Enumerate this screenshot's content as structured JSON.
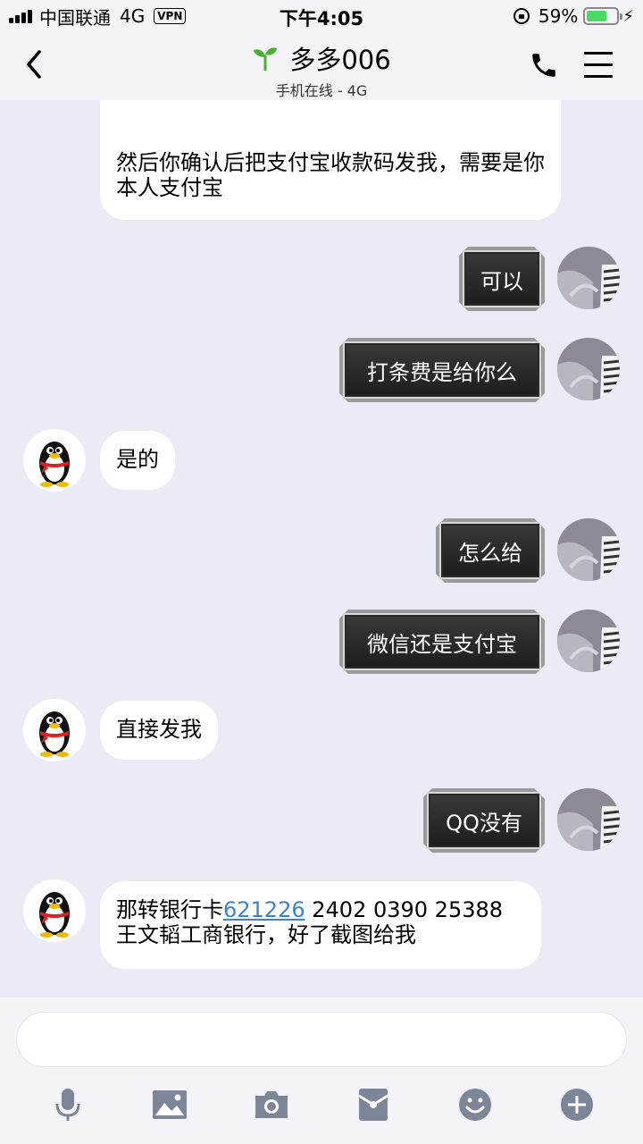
{
  "status_bar": {
    "carrier": "中国联通",
    "network": "4G",
    "vpn": "VPN",
    "time": "下午4:05",
    "battery_percent": "59%",
    "battery_level": 0.59
  },
  "header": {
    "title": "多多006",
    "subtitle": "手机在线 - 4G"
  },
  "messages": [
    {
      "from": "other",
      "text": "然后你确认后把支付宝收款码发我，需要是你本人支付宝"
    },
    {
      "from": "self",
      "text": "可以"
    },
    {
      "from": "self",
      "text": "打条费是给你么"
    },
    {
      "from": "other",
      "text": "是的"
    },
    {
      "from": "self",
      "text": "怎么给"
    },
    {
      "from": "self",
      "text": "微信还是支付宝"
    },
    {
      "from": "other",
      "text": "直接发我"
    },
    {
      "from": "self",
      "text": "QQ没有"
    },
    {
      "from": "other",
      "text_before": "那转银行卡",
      "link": "621226",
      "text_after": " 2402 0390 25388",
      "line2": "王文韬工商银行，好了截图给我"
    }
  ],
  "input": {
    "placeholder": ""
  },
  "toolbar": [
    "microphone-icon",
    "image-icon",
    "camera-icon",
    "red-packet-icon",
    "emoji-icon",
    "plus-icon"
  ],
  "colors": {
    "background": "#ebebf5",
    "link": "#3b82d6",
    "toolbar_icon": "#7d8599",
    "battery": "#4cd964"
  }
}
